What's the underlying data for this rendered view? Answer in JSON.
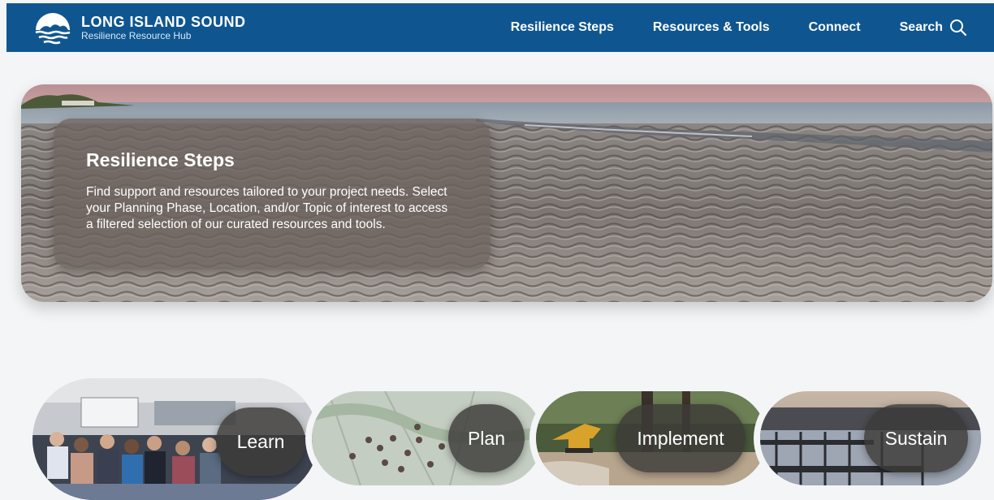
{
  "header": {
    "brand_title": "LONG ISLAND SOUND",
    "brand_subtitle": "Resilience Resource Hub",
    "nav": {
      "resilience_steps": "Resilience Steps",
      "resources_tools": "Resources & Tools",
      "connect": "Connect",
      "search": "Search"
    }
  },
  "hero": {
    "title": "Resilience Steps",
    "description": "Find support and resources tailored to your project needs. Select your Planning Phase, Location, and/or Topic of interest to access a filtered selection of our curated resources and tools."
  },
  "phases": [
    {
      "label": "Learn",
      "image": "conference-audience"
    },
    {
      "label": "Plan",
      "image": "planning-map"
    },
    {
      "label": "Implement",
      "image": "construction-site"
    },
    {
      "label": "Sustain",
      "image": "harbor-docks"
    }
  ],
  "colors": {
    "header_bg": "#0f5690",
    "page_bg": "#f3f5f7"
  }
}
